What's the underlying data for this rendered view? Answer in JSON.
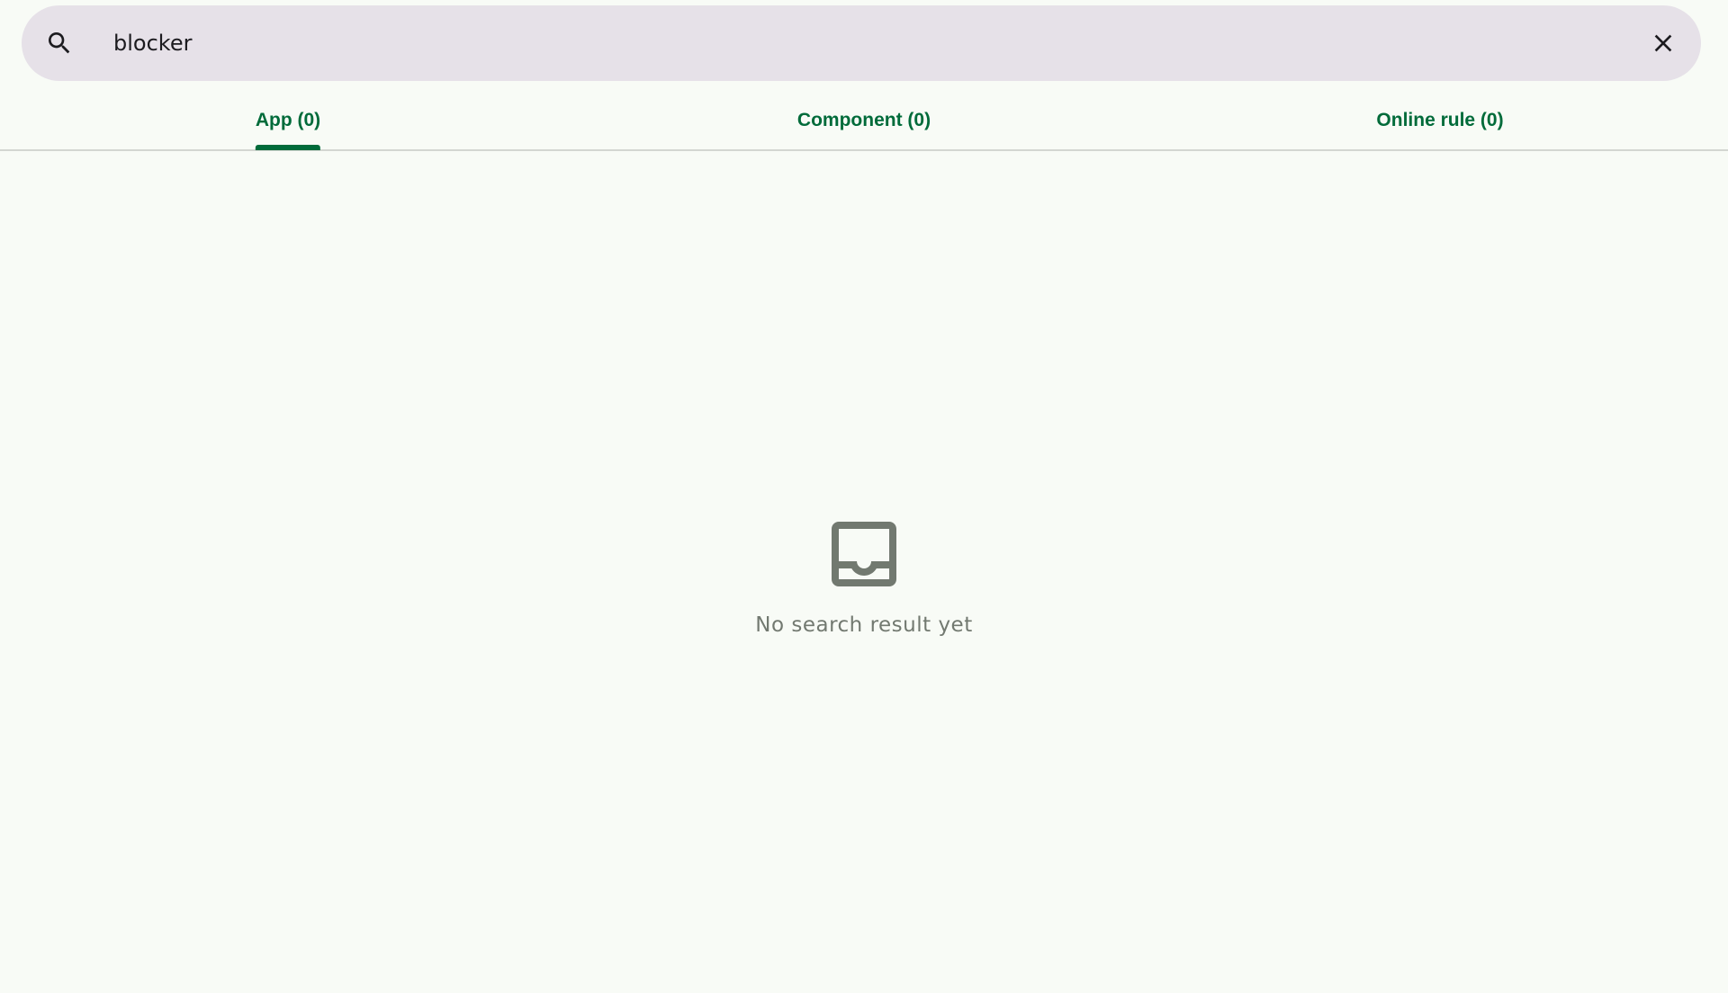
{
  "search": {
    "value": "blocker",
    "icon": "search-icon",
    "clear_icon": "close-icon"
  },
  "tabs": [
    {
      "label": "App (0)",
      "selected": true
    },
    {
      "label": "Component (0)",
      "selected": false
    },
    {
      "label": "Online rule (0)",
      "selected": false
    }
  ],
  "empty_state": {
    "icon": "inbox-icon",
    "message": "No search result yet"
  },
  "colors": {
    "accent": "#006b3a",
    "background": "#f8fbf6",
    "search_bar": "#e6e1e8",
    "muted": "#727970"
  }
}
